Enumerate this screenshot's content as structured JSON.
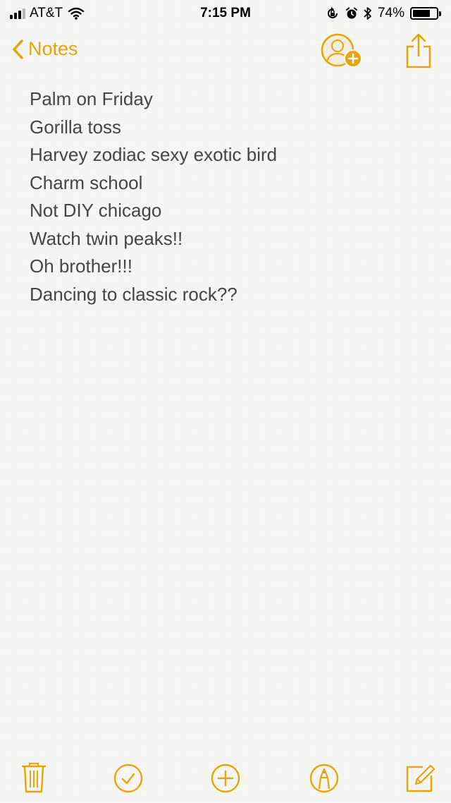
{
  "status_bar": {
    "carrier": "AT&T",
    "time": "7:15 PM",
    "battery_percent": "74%",
    "battery_level": 0.74,
    "icons": [
      "signal-bars-icon",
      "wifi-icon",
      "orientation-lock-icon",
      "alarm-icon",
      "bluetooth-icon",
      "battery-icon"
    ]
  },
  "nav": {
    "back_label": "Notes",
    "icons": [
      "chevron-left-icon",
      "add-people-icon",
      "share-icon"
    ]
  },
  "note": {
    "lines": [
      "Palm on Friday",
      "Gorilla toss",
      "Harvey zodiac sexy exotic bird",
      "Charm school",
      "Not DIY chicago",
      "Watch twin peaks!!",
      "Oh brother!!!",
      "Dancing to classic rock??"
    ]
  },
  "toolbar": {
    "icons": [
      "trash-icon",
      "checklist-icon",
      "add-icon",
      "markup-icon",
      "compose-icon"
    ]
  },
  "colors": {
    "accent": "#e5a50a",
    "text": "#454545",
    "paper": "#f7f7f5"
  }
}
